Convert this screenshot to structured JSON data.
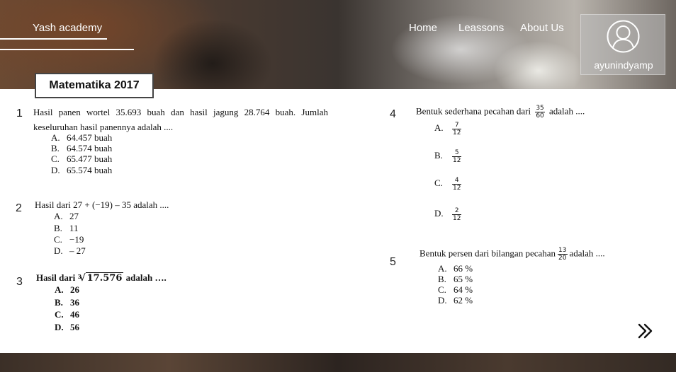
{
  "nav": {
    "brand": "Yash academy",
    "links": [
      "Home",
      "Leassons",
      "About Us"
    ],
    "user": {
      "name": "ayunindyamp",
      "icon": "user-avatar-icon"
    }
  },
  "page_title": "Matematika 2017",
  "questions": [
    {
      "number": "1",
      "text": "Hasil panen wortel 35.693 buah dan hasil jagung 28.764 buah. Jumlah keseluruhan hasil panennya adalah ....",
      "options": [
        {
          "label": "A.",
          "value": "64.457 buah"
        },
        {
          "label": "B.",
          "value": "64.574 buah"
        },
        {
          "label": "C.",
          "value": "65.477 buah"
        },
        {
          "label": "D.",
          "value": "65.574 buah"
        }
      ]
    },
    {
      "number": "2",
      "text": "Hasil dari 27 + (−19) – 35 adalah ....",
      "options": [
        {
          "label": "A.",
          "value": "27"
        },
        {
          "label": "B.",
          "value": "11"
        },
        {
          "label": "C.",
          "value": "−19"
        },
        {
          "label": "D.",
          "value": "– 27"
        }
      ]
    },
    {
      "number": "3",
      "text_before": "Hasil dari",
      "radical_index": "3",
      "radical_body": "17.576",
      "text_after": "adalah ….",
      "options": [
        {
          "label": "A.",
          "value": "26"
        },
        {
          "label": "B.",
          "value": "36"
        },
        {
          "label": "C.",
          "value": "46"
        },
        {
          "label": "D.",
          "value": "56"
        }
      ]
    },
    {
      "number": "4",
      "text_before": "Bentuk sederhana pecahan dari",
      "fraction": {
        "num": "35",
        "den": "60"
      },
      "text_after": "adalah ....",
      "options": [
        {
          "label": "A.",
          "num": "7",
          "den": "12"
        },
        {
          "label": "B.",
          "num": "5",
          "den": "12"
        },
        {
          "label": "C.",
          "num": "4",
          "den": "12"
        },
        {
          "label": "D.",
          "num": "2",
          "den": "12"
        }
      ]
    },
    {
      "number": "5",
      "text_before": "Bentuk persen dari bilangan pecahan",
      "fraction": {
        "num": "13",
        "den": "20"
      },
      "text_after": "adalah ....",
      "options": [
        {
          "label": "A.",
          "value": "66 %"
        },
        {
          "label": "B.",
          "value": "65 %"
        },
        {
          "label": "C.",
          "value": "64 %"
        },
        {
          "label": "D.",
          "value": "62 %"
        }
      ]
    }
  ],
  "next_button": {
    "icon": "double-chevron-right-icon"
  }
}
